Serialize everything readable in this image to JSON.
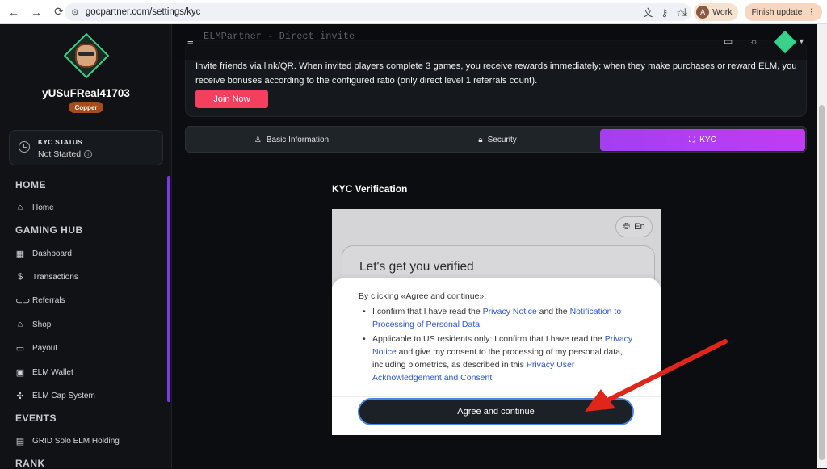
{
  "browser": {
    "url": "gocpartner.com/settings/kyc",
    "profile_initial": "A",
    "profile_label": "Work",
    "update_label": "Finish update"
  },
  "sidebar": {
    "username": "yUSuFReal41703",
    "rank": "Copper",
    "kyc": {
      "title": "KYC STATUS",
      "value": "Not Started"
    },
    "sections": [
      {
        "title": "HOME",
        "items": [
          {
            "label": "Home",
            "icon": "home-icon"
          }
        ]
      },
      {
        "title": "GAMING HUB",
        "items": [
          {
            "label": "Dashboard",
            "icon": "dashboard-icon"
          },
          {
            "label": "Transactions",
            "icon": "dollar-icon"
          },
          {
            "label": "Referrals",
            "icon": "link-icon"
          },
          {
            "label": "Shop",
            "icon": "shop-icon"
          },
          {
            "label": "Payout",
            "icon": "payout-icon"
          },
          {
            "label": "ELM Wallet",
            "icon": "wallet-icon"
          },
          {
            "label": "ELM Cap System",
            "icon": "cap-system-icon"
          }
        ]
      },
      {
        "title": "EVENTS",
        "items": [
          {
            "label": "GRID Solo ELM Holding",
            "icon": "calendar-icon"
          }
        ]
      },
      {
        "title": "RANK",
        "items": []
      }
    ]
  },
  "header": {
    "ghost_text": "ELMPartner - Direct invite"
  },
  "invite": {
    "text": "Invite friends via link/QR. When invited players complete 3 games, you receive rewards immediately; when they make purchases or reward ELM, you receive bonuses according to the configured ratio (only direct level 1 referrals count).",
    "join_label": "Join Now"
  },
  "tabs": [
    {
      "label": "Basic Information",
      "icon": "user-icon",
      "active": false
    },
    {
      "label": "Security",
      "icon": "lock-icon",
      "active": false
    },
    {
      "label": "KYC",
      "icon": "scan-icon",
      "active": true
    }
  ],
  "kyc_section": {
    "heading": "KYC Verification",
    "lang": "En",
    "verify_title": "Let's get you verified",
    "consent_intro": "By clicking «Agree and continue»:",
    "bullet1": {
      "t1": "I confirm that I have read the ",
      "l1": "Privacy Notice",
      "t2": " and the ",
      "l2": "Notification to Processing of Personal Data"
    },
    "bullet2": {
      "t1": "Applicable to US residents only: I confirm that I have read the ",
      "l1": "Privacy Notice",
      "t2": " and give my consent to the processing of my personal data, including biometrics, as described in this ",
      "l2": "Privacy User Acknowledgement and Consent"
    },
    "agree_label": "Agree and continue"
  },
  "annotation": {
    "arrow_color": "#e0261b"
  }
}
